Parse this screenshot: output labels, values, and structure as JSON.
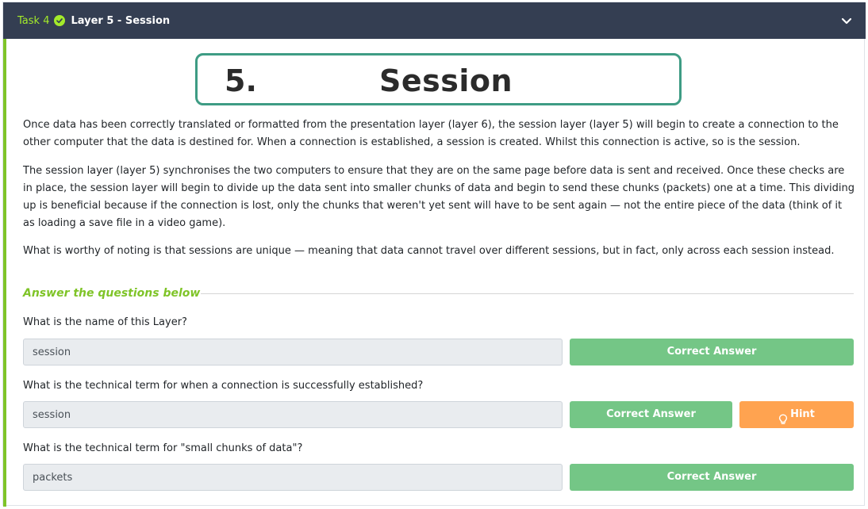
{
  "header": {
    "task_label": "Task 4",
    "title": "Layer 5 - Session",
    "check_icon": "check-circle-icon",
    "toggle_icon": "chevron-down-icon"
  },
  "banner": {
    "number": "5.",
    "word": "Session"
  },
  "content": {
    "paragraphs": [
      "Once data has been correctly translated or formatted from the presentation layer (layer 6), the session layer (layer 5) will begin to create a connection to the other computer that the data is destined for. When a connection is established, a session is created. Whilst this connection is active, so is the session.",
      "The session layer (layer 5) synchronises the two computers to ensure that they are on the same page before data is sent and received. Once these checks are in place, the session layer will begin to divide up the data sent into smaller chunks of data and begin to send these chunks (packets) one at a time. This dividing up is beneficial because if the connection is lost, only the chunks that weren't yet sent will have to be sent again — not the entire piece of the data (think of it as loading a save file in a video game).",
      "What is worthy of noting is that sessions are unique — meaning that data cannot travel over different sessions, but in fact, only across each session instead."
    ]
  },
  "answers_section": {
    "heading": "Answer the questions below",
    "questions": [
      {
        "text": "What is the name of this Layer?",
        "answer": "session",
        "button": "Correct Answer"
      },
      {
        "text": "What is the technical term for when a connection is successfully established?",
        "answer": "session",
        "button": "Correct Answer",
        "hint": "Hint"
      },
      {
        "text": "What is the technical term for \"small chunks of data\"?",
        "answer": "packets",
        "button": "Correct Answer"
      }
    ]
  },
  "colors": {
    "header_bg": "#343e52",
    "accent_green": "#7fc428",
    "correct_button": "#74c686",
    "hint_button": "#ffa350",
    "banner_border": "#3e9c84"
  }
}
